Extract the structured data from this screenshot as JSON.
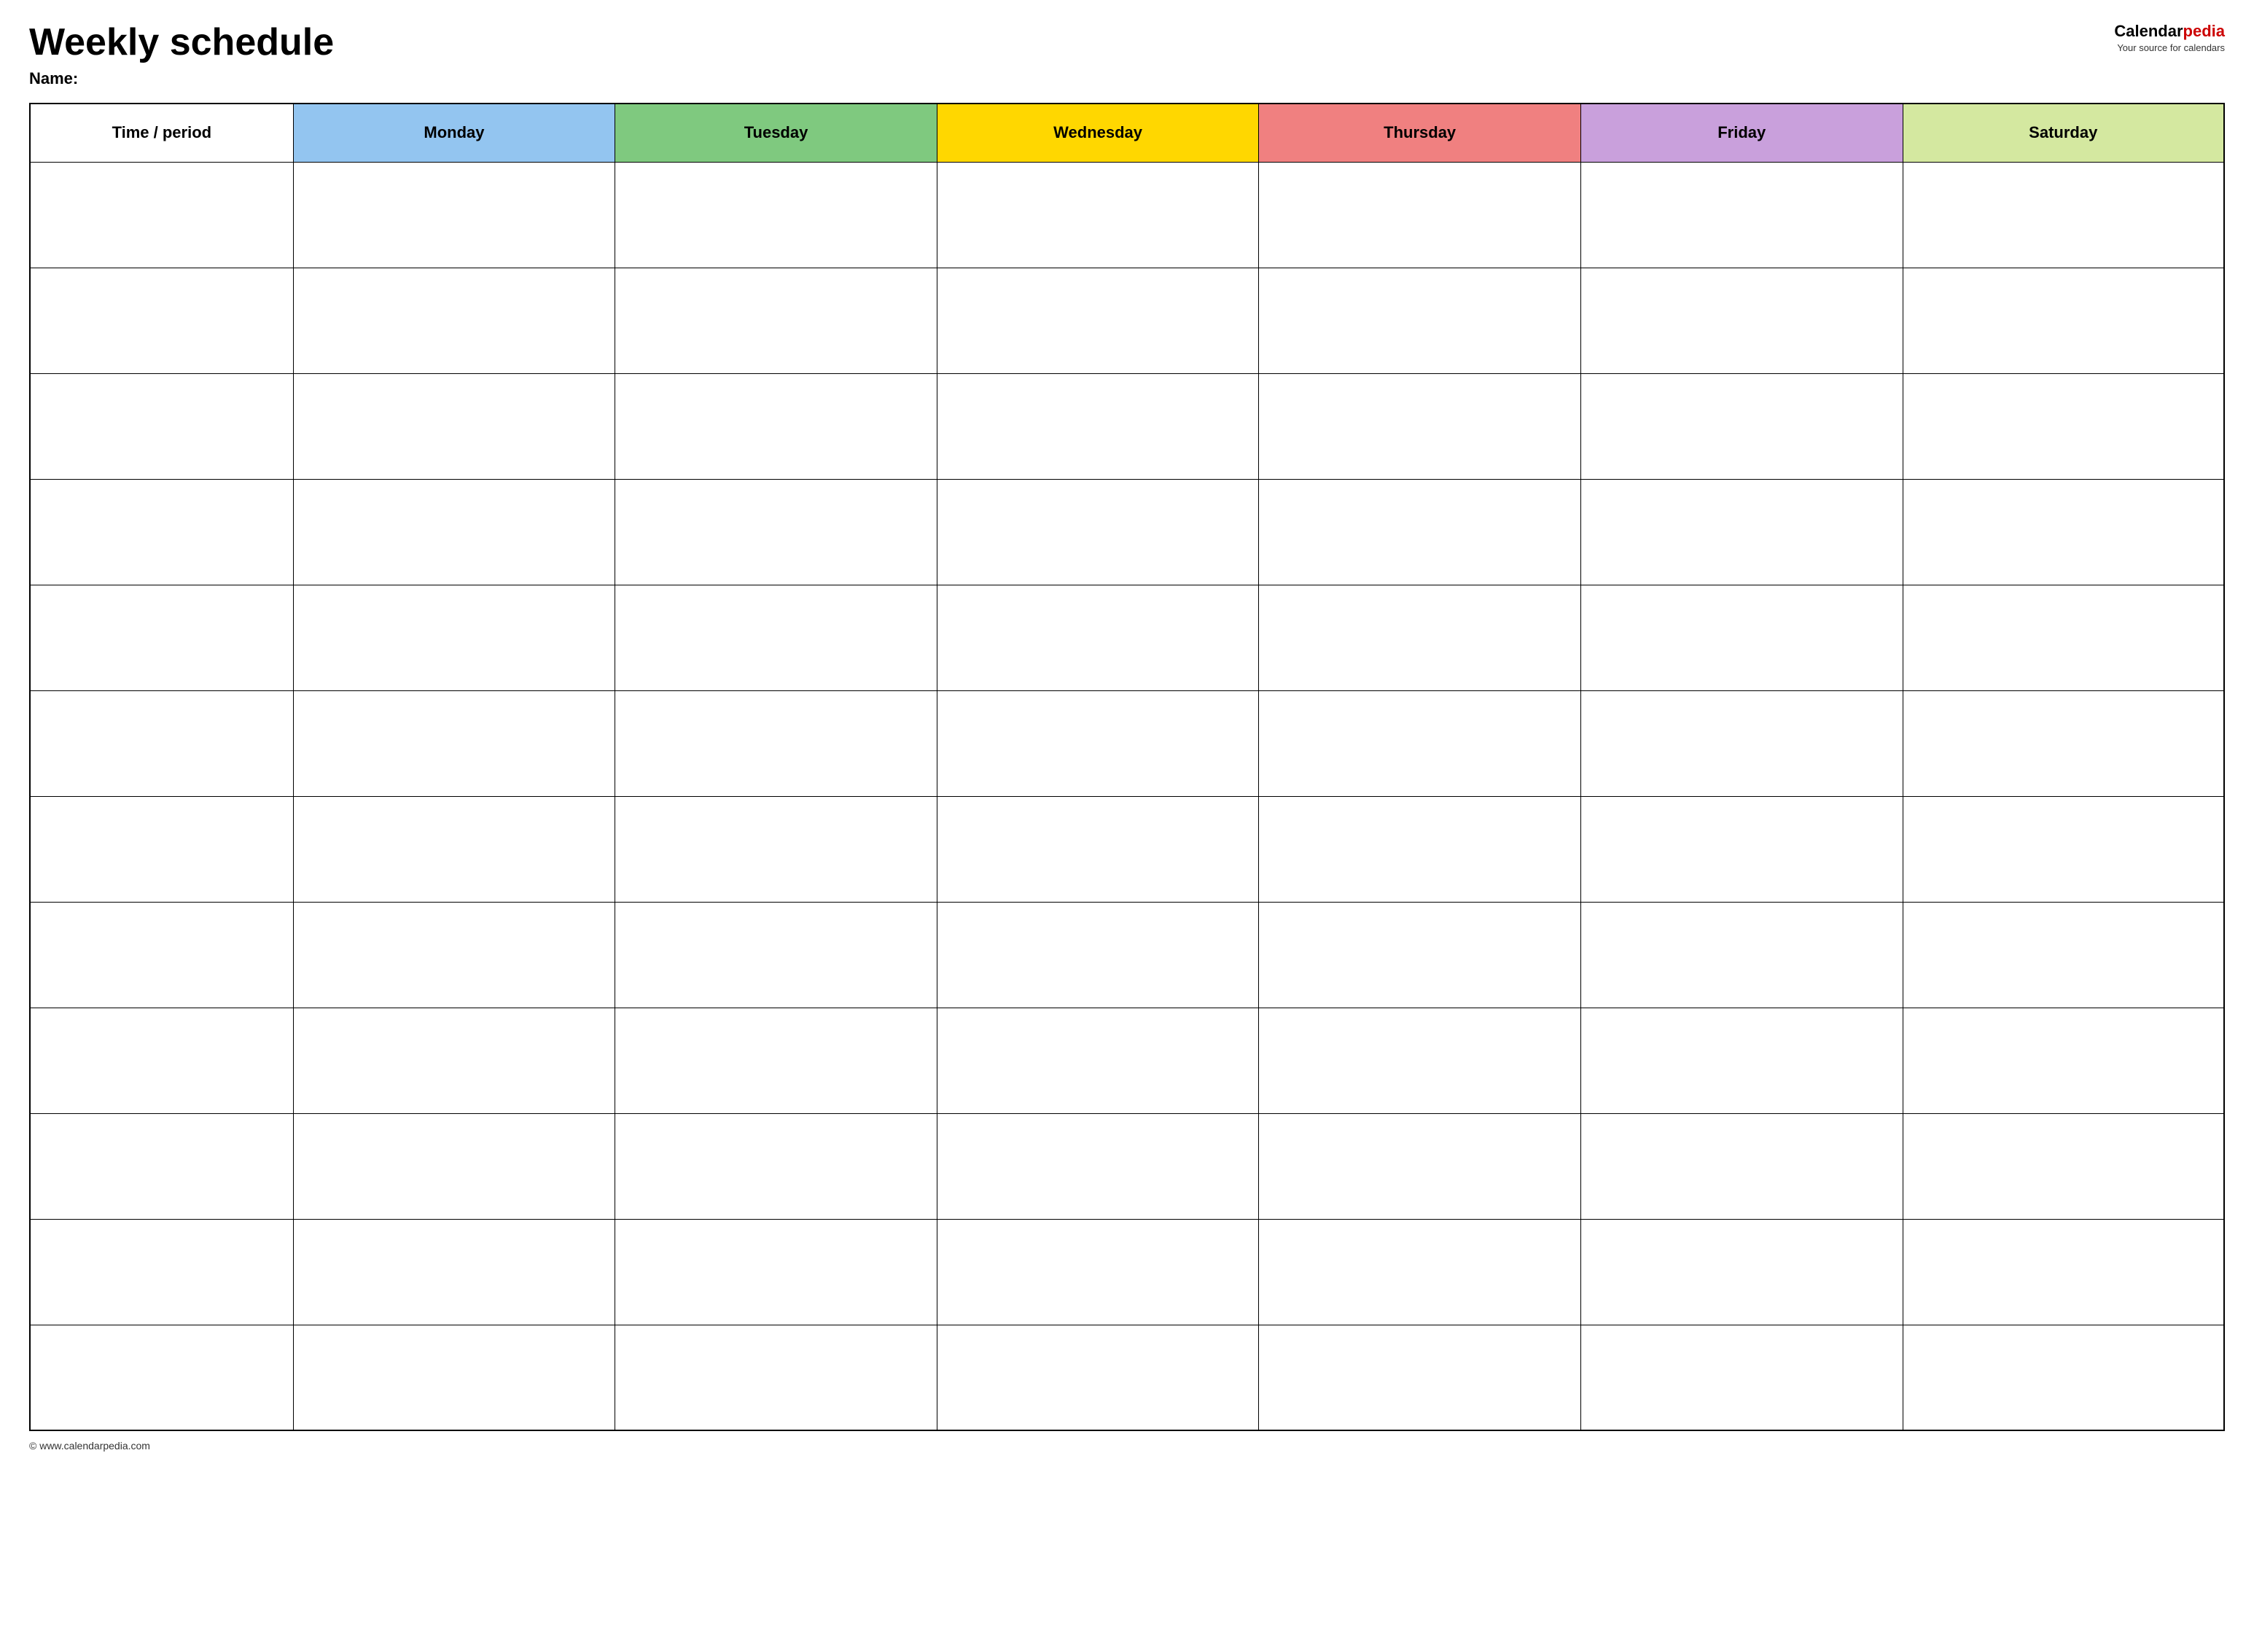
{
  "header": {
    "title": "Weekly schedule",
    "name_label": "Name:",
    "logo": {
      "calendar_part": "Calendar",
      "pedia_part": "pedia",
      "tagline": "Your source for calendars"
    }
  },
  "table": {
    "columns": [
      {
        "id": "time",
        "label": "Time / period",
        "color_class": "header-time"
      },
      {
        "id": "monday",
        "label": "Monday",
        "color_class": "header-monday"
      },
      {
        "id": "tuesday",
        "label": "Tuesday",
        "color_class": "header-tuesday"
      },
      {
        "id": "wednesday",
        "label": "Wednesday",
        "color_class": "header-wednesday"
      },
      {
        "id": "thursday",
        "label": "Thursday",
        "color_class": "header-thursday"
      },
      {
        "id": "friday",
        "label": "Friday",
        "color_class": "header-friday"
      },
      {
        "id": "saturday",
        "label": "Saturday",
        "color_class": "header-saturday"
      }
    ],
    "row_count": 12
  },
  "footer": {
    "url": "© www.calendarpedia.com"
  }
}
